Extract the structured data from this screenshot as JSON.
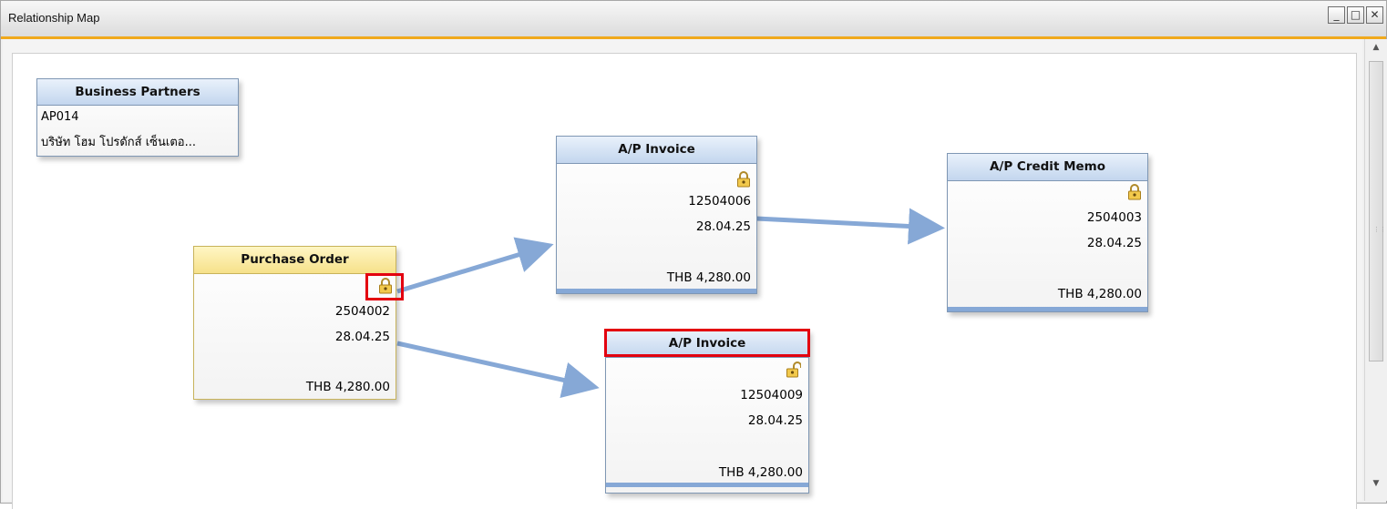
{
  "window": {
    "title": "Relationship Map",
    "buttons": {
      "minimize": "_",
      "maximize": "□",
      "close": "✕"
    }
  },
  "business_partners": {
    "header": "Business Partners",
    "code": "AP014",
    "name": "บริษัท โฮม โปรดักส์ เซ็นเตอ..."
  },
  "purchase_order": {
    "header": "Purchase Order",
    "number": "2504002",
    "date": "28.04.25",
    "amount": "THB 4,280.00",
    "icon": "closed-lock-icon"
  },
  "ap_invoice_1": {
    "header": "A/P Invoice",
    "number": "12504006",
    "date": "28.04.25",
    "amount": "THB 4,280.00",
    "icon": "closed-lock-icon"
  },
  "ap_invoice_2": {
    "header": "A/P Invoice",
    "number": "12504009",
    "date": "28.04.25",
    "amount": "THB 4,280.00",
    "icon": "open-lock-icon"
  },
  "ap_credit_memo": {
    "header": "A/P Credit Memo",
    "number": "2504003",
    "date": "28.04.25",
    "amount": "THB 4,280.00",
    "icon": "closed-lock-icon"
  },
  "colors": {
    "accent": "#f0a91c",
    "connector": "#86a8d6",
    "highlight": "#e3000f",
    "node_header": "#c3d6ee",
    "po_header": "#f6e18a"
  }
}
